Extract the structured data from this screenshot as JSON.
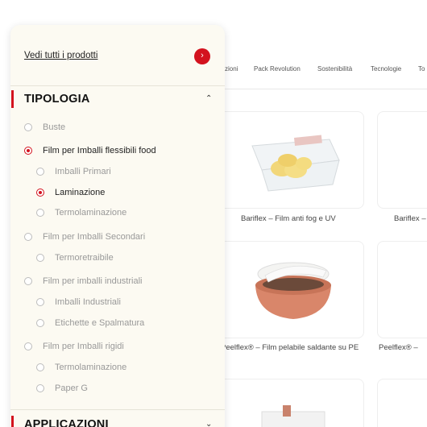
{
  "nav": {
    "items": [
      "zioni",
      "Pack Revolution",
      "Sostenibilità",
      "Tecnologie",
      "To"
    ]
  },
  "products": [
    {
      "label": "Bariflex – Film anti fog e UV"
    },
    {
      "label": "Bariflex –"
    },
    {
      "label": "Peelflex® – Film pelabile saldante su PE"
    },
    {
      "label": "Peelflex® –"
    }
  ],
  "filter": {
    "view_all": "Vedi tutti i prodotti",
    "view_all_icon": "chevron-right-icon",
    "sections": [
      {
        "title": "TIPOLOGIA",
        "expanded": true
      },
      {
        "title": "APPLICAZIONI",
        "expanded": false
      }
    ],
    "options": [
      {
        "label": "Buste",
        "level": 1,
        "selected": false
      },
      {
        "label": "Film per Imballi flessibili food",
        "level": 1,
        "selected": true
      },
      {
        "label": "Imballi Primari",
        "level": 2,
        "selected": false
      },
      {
        "label": "Laminazione",
        "level": 2,
        "selected": true
      },
      {
        "label": "Termolaminazione",
        "level": 2,
        "selected": false
      },
      {
        "label": "Film per Imballi Secondari",
        "level": 1,
        "selected": false
      },
      {
        "label": "Termoretraibile",
        "level": 2,
        "selected": false
      },
      {
        "label": "Film per imballi industriali",
        "level": 1,
        "selected": false
      },
      {
        "label": "Imballi Industriali",
        "level": 2,
        "selected": false
      },
      {
        "label": "Etichette e Spalmatura",
        "level": 2,
        "selected": false
      },
      {
        "label": "Film per Imballi rigidi",
        "level": 1,
        "selected": false
      },
      {
        "label": "Termolaminazione",
        "level": 2,
        "selected": false
      },
      {
        "label": "Paper G",
        "level": 2,
        "selected": false
      }
    ]
  },
  "colors": {
    "accent": "#d3121e",
    "panel_bg": "#fcfaf2"
  }
}
